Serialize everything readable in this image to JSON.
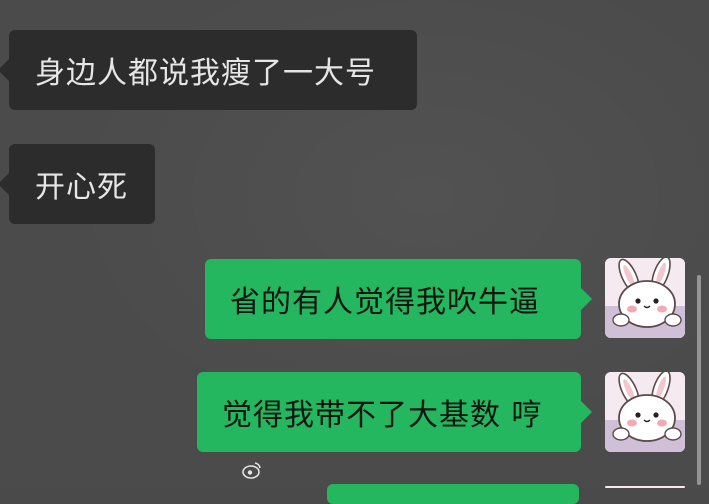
{
  "messages": [
    {
      "side": "received",
      "text": "身边人都说我瘦了一大号"
    },
    {
      "side": "received",
      "text": "开心死"
    },
    {
      "side": "sent",
      "text": "省的有人觉得我吹牛逼"
    },
    {
      "side": "sent",
      "text": "觉得我带不了大基数 哼"
    }
  ],
  "watermark": {
    "icon": "weibo-icon"
  },
  "colors": {
    "background": "#4b4b4b",
    "received_bubble": "#2c2c2c",
    "sent_bubble": "#25b660"
  }
}
